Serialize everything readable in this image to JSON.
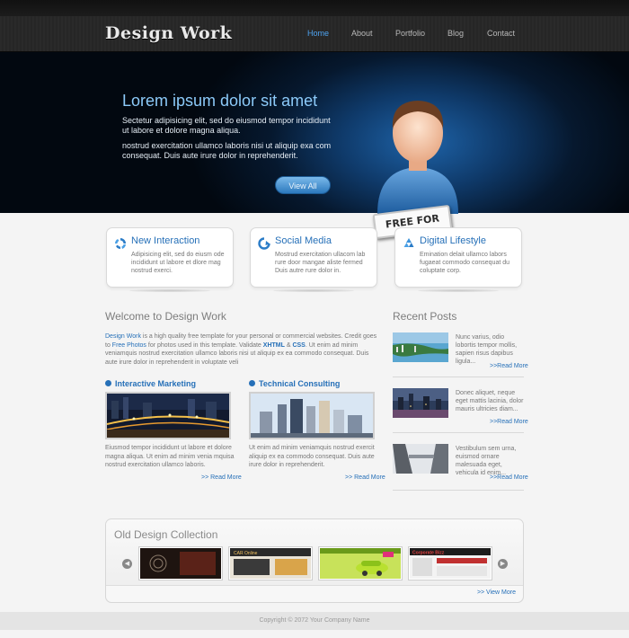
{
  "header": {
    "logo": "Design Work",
    "nav": [
      {
        "label": "Home",
        "active": true
      },
      {
        "label": "About"
      },
      {
        "label": "Portfolio"
      },
      {
        "label": "Blog"
      },
      {
        "label": "Contact"
      }
    ]
  },
  "hero": {
    "title": "Lorem ipsum dolor sit amet",
    "para1": "Sectetur adipisicing elit, sed do eiusmod tempor incididunt ut labore et dolore magna aliqua.",
    "para2": "nostrud exercitation ullamco laboris nisi ut aliquip exa com consequat. Duis aute irure dolor in reprehenderit.",
    "button": "View All",
    "badge": "FREE FOR JOB"
  },
  "features": [
    {
      "title": "New Interaction",
      "text": "Adipisicing elit, sed do eiusm ode incididunt ut labore et dlore mag nostrud exerci.",
      "icon": "recycle-arrows-icon"
    },
    {
      "title": "Social Media",
      "text": "Mostrud exercitation ullacom lab rure door mangae aliste fermed Duis autre rure dolor in.",
      "icon": "refresh-arrow-icon"
    },
    {
      "title": "Digital Lifestyle",
      "text": "Emination delait ullamco labors fugaeat commodo consequat du coluptate corp.",
      "icon": "recycle-icon"
    }
  ],
  "welcome": {
    "title": "Welcome to Design Work",
    "text_link1": "Design Work",
    "text_a": " is a high quality free template for your personal or commercial websites. Credit goes to ",
    "text_link2": "Free Photos",
    "text_b": " for photos used in this template. Validate ",
    "text_xhtml": "XHTML",
    "text_amp": " & ",
    "text_css": "CSS",
    "text_c": ". Ut enim ad minim veniamquis nostrud exercitation ullamco laboris nisi ut aliquip ex ea commodo consequat. Duis aute irure dolor in reprehenderit in voluptate veli"
  },
  "subsections": [
    {
      "title": "Interactive Marketing",
      "text": "Eiusmod tempor incididunt ut labore et dolore magna aliqua. Ut enim ad minim venia mquisa nostrud exercitation ullamco laboris.",
      "read_more": ">> Read More"
    },
    {
      "title": "Technical Consulting",
      "text": "Ut enim ad minim veniamquis nostrud exercit aliquip ex ea commodo consequat. Duis aute irure dolor in reprehenderit.",
      "read_more": ">> Read More"
    }
  ],
  "recent_posts": {
    "title": "Recent Posts",
    "items": [
      {
        "text": "Nunc varius, odio lobortis tempor mollis, sapien risus dapibus ligula...",
        "read_more": ">>Read More"
      },
      {
        "text": "Donec aliquet, neque eget mattis lacinia, dolor mauris ultricies diam...",
        "read_more": ">>Read More"
      },
      {
        "text": "Vestibulum sem urna, euismod ornare malesuada eget, vehicula id enim...",
        "read_more": ">>Read More"
      }
    ]
  },
  "collection": {
    "title": "Old Design Collection",
    "view_more": ">> View More",
    "slides": [
      {
        "label": ""
      },
      {
        "label": "CAR Online"
      },
      {
        "label": ""
      },
      {
        "label": "Corporate Bizz"
      }
    ]
  },
  "footer": {
    "copyright": "Copyright © 2072 Your Company Name"
  },
  "colors": {
    "accent": "#2670b8",
    "nav_active": "#4ea3f0",
    "hero_title": "#8ccaf9"
  }
}
